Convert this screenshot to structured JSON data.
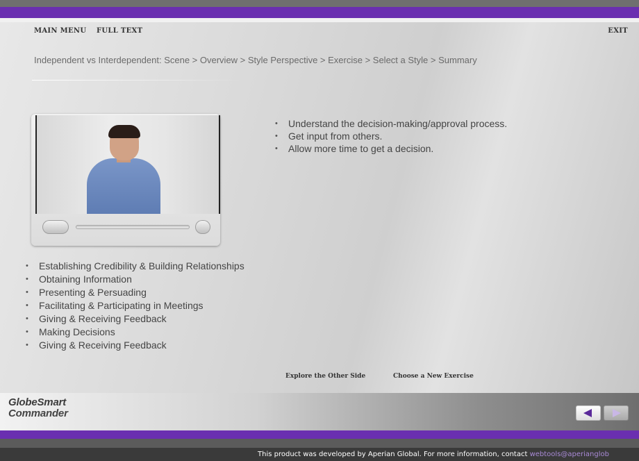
{
  "top_menu": {
    "main_menu": "MAIN MENU",
    "full_text": "FULL TEXT",
    "exit": "EXIT"
  },
  "breadcrumb": "Independent vs Interdependent: Scene > Overview > Style Perspective > Exercise > Select a Style > Summary",
  "video": {
    "player_controls": [
      "play-button",
      "progress-track",
      "volume-button"
    ]
  },
  "right_bullets": [
    "Understand the decision-making/approval process.",
    "Get input from others.",
    "Allow more time to get a decision."
  ],
  "left_bullets": [
    "Establishing Credibility & Building Relationships",
    "Obtaining Information",
    "Presenting & Persuading",
    "Facilitating & Participating in Meetings",
    "Giving & Receiving Feedback",
    "Making Decisions",
    "Giving & Receiving Feedback"
  ],
  "bottom_links": {
    "explore": "Explore the Other Side",
    "choose": "Choose a New Exercise"
  },
  "logo": {
    "line1": "GlobeSmart",
    "line2": "Commander"
  },
  "nav": {
    "back_icon": "arrow-left-icon",
    "next_icon": "arrow-right-icon"
  },
  "credit": {
    "text": "This product was developed by Aperian Global.  For more information, contact ",
    "link": "webtools@aperianglob"
  },
  "colors": {
    "accent_purple": "#6a2fb0",
    "arrow_purple": "#5b2a9a"
  }
}
